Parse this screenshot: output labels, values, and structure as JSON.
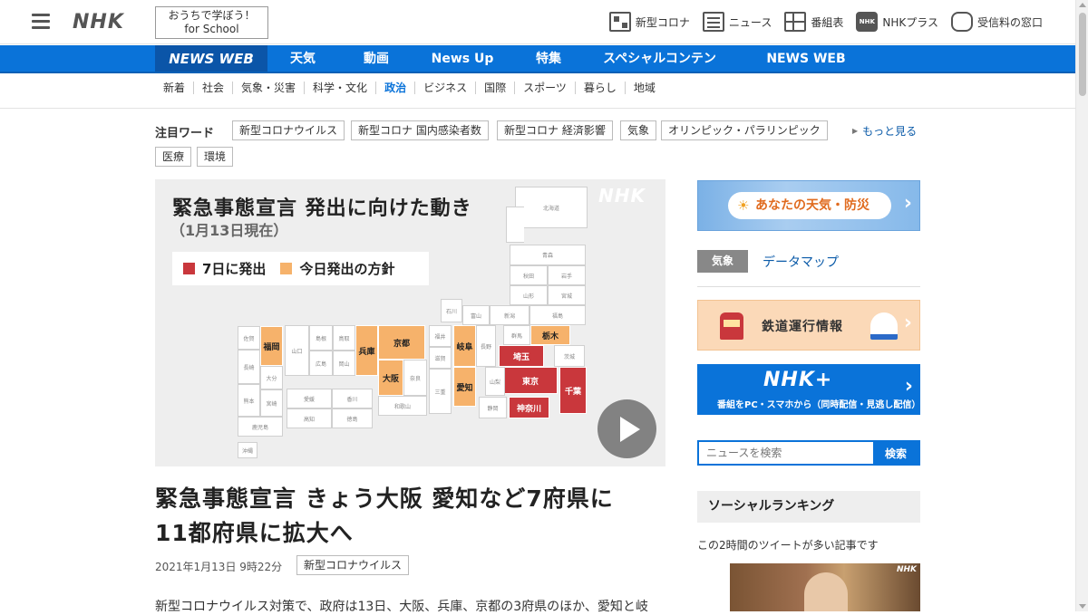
{
  "header": {
    "logo": "NHK",
    "school_line1": "おうちで学ぼう！",
    "school_line2": "for School",
    "links": [
      {
        "label": "新型コロナ",
        "icon": "qr-icon"
      },
      {
        "label": "ニュース",
        "icon": "news-icon"
      },
      {
        "label": "番組表",
        "icon": "grid-icon"
      },
      {
        "label": "NHKプラス",
        "icon": "nhkplus-icon"
      },
      {
        "label": "受信料の窓口",
        "icon": "tv-icon"
      }
    ]
  },
  "nav": {
    "items": [
      "NEWS WEB",
      "天気",
      "動画",
      "News Up",
      "特集",
      "スペシャルコンテンツ",
      "NEWS WEB EASY"
    ]
  },
  "subnav": {
    "items": [
      "新着",
      "社会",
      "気象・災害",
      "科学・文化",
      "政治",
      "ビジネス",
      "国際",
      "スポーツ",
      "暮らし",
      "地域"
    ],
    "current": "政治"
  },
  "attention": {
    "label": "注目ワード",
    "tags": [
      "新型コロナウイルス",
      "新型コロナ 国内感染者数",
      "新型コロナ 経済影響",
      "気象",
      "オリンピック・パラリンピック",
      "医療",
      "環境"
    ],
    "more": "もっと見る"
  },
  "map": {
    "title": "緊急事態宣言 発出に向けた動き",
    "subtitle": "（1月13日現在）",
    "watermark": "NHK",
    "legend_red": "7日に発出",
    "legend_orange": "今日発出の方針",
    "color_red": "#c9373c",
    "color_orange": "#f6b26b",
    "prefs": {
      "hokkaido": "北海道",
      "aomori": "青森",
      "akita": "秋田",
      "iwate": "岩手",
      "yamagata": "山形",
      "miyagi": "宮城",
      "ishikawa": "石川",
      "toyama": "富山",
      "niigata": "新潟",
      "fukushima": "福島",
      "tochigi": "栃木",
      "gunma": "群馬",
      "ibaraki": "茨城",
      "saitama": "埼玉",
      "tokyo": "東京",
      "chiba": "千葉",
      "kanagawa": "神奈川",
      "yamanashi": "山梨",
      "shizuoka": "静岡",
      "nagano": "長野",
      "gifu": "岐阜",
      "aichi": "愛知",
      "fukui": "福井",
      "shiga": "滋賀",
      "mie": "三重",
      "kyoto": "京都",
      "osaka": "大阪",
      "hyogo": "兵庫",
      "nara": "奈良",
      "wakayama": "和歌山",
      "shimane": "島根",
      "tottori": "鳥取",
      "hiroshima": "広島",
      "okayama": "岡山",
      "yamaguchi": "山口",
      "ehime": "愛媛",
      "kagawa": "香川",
      "kochi": "高知",
      "tokushima": "徳島",
      "saga": "佐賀",
      "fukuoka": "福岡",
      "nagasaki": "長崎",
      "oita": "大分",
      "kumamoto": "熊本",
      "miyazaki": "宮崎",
      "kagoshima": "鹿児島",
      "okinawa": "沖縄"
    }
  },
  "article": {
    "headline_line1": "緊急事態宣言 きょう大阪 愛知など7府県に",
    "headline_line2": "11都府県に拡大へ",
    "date": "2021年1月13日 9時22分",
    "tag": "新型コロナウイルス",
    "body": "新型コロナウイルス対策で、政府は13日、大阪、兵庫、京都の3府県のほか、愛知と岐"
  },
  "sidebar": {
    "weather_banner": "あなたの天気・防災",
    "kisho_label": "気象",
    "datamap_link": "データマップ",
    "rail_banner": "鉄道運行情報",
    "plus_big": "NHK+",
    "plus_small": "番組をPC・スマホから（同時配信・見逃し配信）",
    "search_placeholder": "ニュースを検索",
    "search_button": "検索",
    "social_title": "ソーシャルランキング",
    "social_sub": "この2時間のツイートが多い記事です",
    "thumb_watermark": "NHK"
  }
}
